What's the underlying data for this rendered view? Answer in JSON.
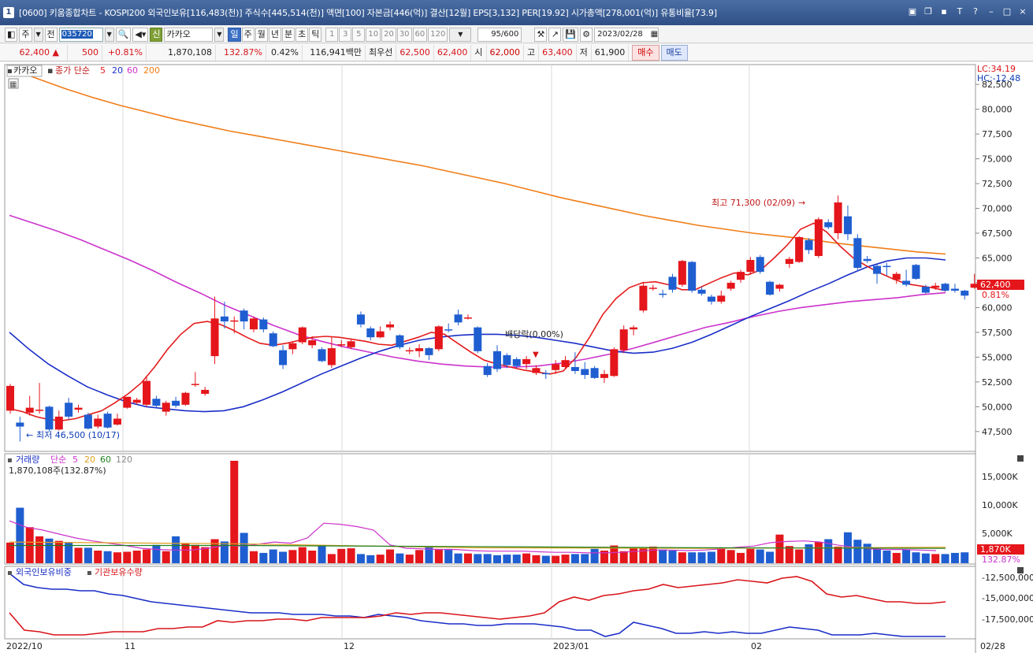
{
  "window": {
    "number": "1",
    "title": "[0600] 키움종합차트 - KOSPI200 외국인보유[116,483(천)] 주식수[445,514(천)] 액면[100] 자본금[446(억)] 결산[12월] EPS[3,132] PER[19.92] 시가총액[278,001(억)] 유통비율[73.9]"
  },
  "toolbar": {
    "market": "주",
    "all": "전",
    "code": "035720",
    "mode_badge": "신",
    "stock_name": "카카오",
    "periods": [
      "일",
      "주",
      "월",
      "년",
      "분",
      "초",
      "틱"
    ],
    "active_period": "일",
    "intervals": [
      "1",
      "3",
      "5",
      "10",
      "20",
      "30",
      "60",
      "120"
    ],
    "count": "95/600",
    "date": "2023/02/28"
  },
  "quote": {
    "price": "62,400",
    "change": "500",
    "rate": "+0.81%",
    "volume": "1,870,108",
    "vol_ratio": "132.87%",
    "turnover": "0.42%",
    "amount": "116,941백만",
    "pref_label": "최우선",
    "ask": "62,500",
    "bid": "62,400",
    "open_label": "시",
    "open": "62,000",
    "high_label": "고",
    "high": "63,400",
    "low_label": "저",
    "low": "61,900",
    "buy": "매수",
    "sell": "매도"
  },
  "price_panel": {
    "name_tag": "카카오",
    "ma_label": "종가 단순",
    "ma_periods": [
      "5",
      "20",
      "60",
      "200"
    ],
    "lc": "LC:34.19",
    "hc": "HC:-12.48",
    "current_tag": "62,400",
    "current_rate": "0.81%",
    "max_annot": "최고 71,300 (02/09)",
    "min_annot": "최저 46,500 (10/17)",
    "div_annot": "배당락(0.00%)"
  },
  "volume_panel": {
    "label": "거래량",
    "ma_label": "단순",
    "ma_periods": [
      "5",
      "20",
      "60",
      "120"
    ],
    "value_text": "1,870,108주(132.87%)",
    "axis": [
      "15,000K",
      "10,000K",
      "5,000K"
    ],
    "tag_value": "1,870K",
    "tag_rate": "132.87%"
  },
  "foreign_panel": {
    "label1": "외국인보유비중",
    "label2": "기관보유수량",
    "axis": [
      "-12,500,000",
      "-15,000,000",
      "-17,500,000"
    ]
  },
  "x_labels": [
    "2022/10",
    "11",
    "12",
    "2023/01",
    "02",
    "02/28"
  ],
  "colors": {
    "up": "#e4161b",
    "down": "#1f5ed1",
    "ma5": "#e41c1c",
    "ma20": "#1a2ec8",
    "ma60": "#cc33cc",
    "ma200": "#f07d18"
  },
  "chart_data": {
    "type": "candlestick",
    "ylim": [
      45500,
      84500
    ],
    "yticks": [
      82500,
      80000,
      77500,
      75000,
      72500,
      70000,
      67500,
      65000,
      62500,
      60000,
      57500,
      55000,
      52500,
      50000,
      47500
    ],
    "candles": [
      {
        "o": 49600,
        "c": 52100,
        "h": 52300,
        "l": 49300
      },
      {
        "o": 48400,
        "c": 48000,
        "h": 49000,
        "l": 46500
      },
      {
        "o": 49400,
        "c": 49900,
        "h": 51100,
        "l": 49100
      },
      {
        "o": 49600,
        "c": 49700,
        "h": 52400,
        "l": 49300
      },
      {
        "o": 50000,
        "c": 47700,
        "h": 50100,
        "l": 47500
      },
      {
        "o": 47700,
        "c": 49000,
        "h": 49600,
        "l": 47600
      },
      {
        "o": 50400,
        "c": 49000,
        "h": 50900,
        "l": 48700
      },
      {
        "o": 49700,
        "c": 49900,
        "h": 50200,
        "l": 49400
      },
      {
        "o": 49200,
        "c": 47800,
        "h": 49400,
        "l": 47700
      },
      {
        "o": 48000,
        "c": 48800,
        "h": 49200,
        "l": 47800
      },
      {
        "o": 49300,
        "c": 47900,
        "h": 49500,
        "l": 47800
      },
      {
        "o": 48200,
        "c": 48800,
        "h": 49300,
        "l": 48100
      },
      {
        "o": 49900,
        "c": 51000,
        "h": 51000,
        "l": 49800
      },
      {
        "o": 50400,
        "c": 50700,
        "h": 50900,
        "l": 50200
      },
      {
        "o": 50200,
        "c": 52600,
        "h": 53100,
        "l": 50000
      },
      {
        "o": 50800,
        "c": 50100,
        "h": 51100,
        "l": 49900
      },
      {
        "o": 49500,
        "c": 50400,
        "h": 50600,
        "l": 49100
      },
      {
        "o": 50600,
        "c": 50100,
        "h": 51000,
        "l": 49900
      },
      {
        "o": 50200,
        "c": 51400,
        "h": 51500,
        "l": 50100
      },
      {
        "o": 52200,
        "c": 52300,
        "h": 53500,
        "l": 52000
      },
      {
        "o": 51300,
        "c": 51700,
        "h": 52000,
        "l": 51100
      },
      {
        "o": 55100,
        "c": 58900,
        "h": 61100,
        "l": 54300
      },
      {
        "o": 59100,
        "c": 58600,
        "h": 60600,
        "l": 57900
      },
      {
        "o": 58600,
        "c": 58700,
        "h": 59100,
        "l": 57400
      },
      {
        "o": 59700,
        "c": 58600,
        "h": 59900,
        "l": 57800
      },
      {
        "o": 57800,
        "c": 58900,
        "h": 59100,
        "l": 57500
      },
      {
        "o": 58800,
        "c": 57800,
        "h": 59000,
        "l": 57500
      },
      {
        "o": 57400,
        "c": 56100,
        "h": 57600,
        "l": 56000
      },
      {
        "o": 55700,
        "c": 54200,
        "h": 56200,
        "l": 53800
      },
      {
        "o": 55800,
        "c": 56400,
        "h": 56500,
        "l": 55300
      },
      {
        "o": 56500,
        "c": 58000,
        "h": 58100,
        "l": 56300
      },
      {
        "o": 56200,
        "c": 56700,
        "h": 57100,
        "l": 55900
      },
      {
        "o": 55800,
        "c": 54600,
        "h": 56000,
        "l": 54500
      },
      {
        "o": 54200,
        "c": 55900,
        "h": 57000,
        "l": 53900
      },
      {
        "o": 56300,
        "c": 56300,
        "h": 56700,
        "l": 56000
      },
      {
        "o": 56000,
        "c": 56600,
        "h": 56800,
        "l": 55800
      },
      {
        "o": 59300,
        "c": 58300,
        "h": 59600,
        "l": 58000
      },
      {
        "o": 57900,
        "c": 57000,
        "h": 58100,
        "l": 56700
      },
      {
        "o": 57000,
        "c": 57600,
        "h": 58100,
        "l": 56900
      },
      {
        "o": 58000,
        "c": 58300,
        "h": 58600,
        "l": 57700
      },
      {
        "o": 57200,
        "c": 56000,
        "h": 57300,
        "l": 55800
      },
      {
        "o": 55700,
        "c": 55700,
        "h": 56000,
        "l": 55300
      },
      {
        "o": 55600,
        "c": 55900,
        "h": 56300,
        "l": 55000
      },
      {
        "o": 55900,
        "c": 55200,
        "h": 56000,
        "l": 54700
      },
      {
        "o": 55800,
        "c": 58100,
        "h": 58200,
        "l": 55600
      },
      {
        "o": 57800,
        "c": 57700,
        "h": 58400,
        "l": 57500
      },
      {
        "o": 59300,
        "c": 58500,
        "h": 59800,
        "l": 58200
      },
      {
        "o": 59000,
        "c": 59000,
        "h": 59300,
        "l": 58800
      },
      {
        "o": 58000,
        "c": 55600,
        "h": 58100,
        "l": 55400
      },
      {
        "o": 54100,
        "c": 53200,
        "h": 54400,
        "l": 53000
      },
      {
        "o": 55600,
        "c": 53800,
        "h": 56200,
        "l": 53500
      },
      {
        "o": 55200,
        "c": 54200,
        "h": 55400,
        "l": 53900
      },
      {
        "o": 54800,
        "c": 54100,
        "h": 55000,
        "l": 53900
      },
      {
        "o": 54300,
        "c": 54800,
        "h": 55100,
        "l": 53800
      },
      {
        "o": 53400,
        "c": 53900,
        "h": 54200,
        "l": 53200
      },
      {
        "o": 53400,
        "c": 53300,
        "h": 53700,
        "l": 52800
      },
      {
        "o": 53700,
        "c": 54300,
        "h": 54700,
        "l": 53300
      },
      {
        "o": 54000,
        "c": 54700,
        "h": 55100,
        "l": 53800
      },
      {
        "o": 54000,
        "c": 53600,
        "h": 55500,
        "l": 53300
      },
      {
        "o": 53800,
        "c": 53200,
        "h": 54500,
        "l": 52800
      },
      {
        "o": 53900,
        "c": 52900,
        "h": 54100,
        "l": 52800
      },
      {
        "o": 52900,
        "c": 53300,
        "h": 53700,
        "l": 52400
      },
      {
        "o": 53100,
        "c": 55800,
        "h": 56000,
        "l": 53000
      },
      {
        "o": 55700,
        "c": 57800,
        "h": 58200,
        "l": 55400
      },
      {
        "o": 57800,
        "c": 58000,
        "h": 58200,
        "l": 57200
      },
      {
        "o": 59700,
        "c": 62200,
        "h": 62600,
        "l": 59500
      },
      {
        "o": 62000,
        "c": 62000,
        "h": 62300,
        "l": 61700
      },
      {
        "o": 61400,
        "c": 61300,
        "h": 61800,
        "l": 61000
      },
      {
        "o": 63100,
        "c": 61800,
        "h": 63400,
        "l": 61500
      },
      {
        "o": 62300,
        "c": 64700,
        "h": 64800,
        "l": 62100
      },
      {
        "o": 64600,
        "c": 61700,
        "h": 64700,
        "l": 61500
      },
      {
        "o": 61800,
        "c": 61400,
        "h": 62100,
        "l": 61200
      },
      {
        "o": 61100,
        "c": 60600,
        "h": 61300,
        "l": 60300
      },
      {
        "o": 60600,
        "c": 61200,
        "h": 61700,
        "l": 60400
      },
      {
        "o": 61900,
        "c": 62500,
        "h": 62700,
        "l": 61700
      },
      {
        "o": 62800,
        "c": 63600,
        "h": 63800,
        "l": 62500
      },
      {
        "o": 63600,
        "c": 64800,
        "h": 65100,
        "l": 63300
      },
      {
        "o": 65100,
        "c": 63600,
        "h": 65300,
        "l": 63400
      },
      {
        "o": 62600,
        "c": 61300,
        "h": 62700,
        "l": 61200
      },
      {
        "o": 61900,
        "c": 62300,
        "h": 62400,
        "l": 61600
      },
      {
        "o": 64400,
        "c": 64900,
        "h": 65100,
        "l": 64000
      },
      {
        "o": 64600,
        "c": 67100,
        "h": 67200,
        "l": 64500
      },
      {
        "o": 66800,
        "c": 65800,
        "h": 67000,
        "l": 65400
      },
      {
        "o": 65200,
        "c": 68900,
        "h": 69100,
        "l": 65000
      },
      {
        "o": 68600,
        "c": 68100,
        "h": 68900,
        "l": 67900
      },
      {
        "o": 67500,
        "c": 70600,
        "h": 71300,
        "l": 66900
      },
      {
        "o": 69200,
        "c": 67400,
        "h": 70300,
        "l": 66800
      },
      {
        "o": 67000,
        "c": 64000,
        "h": 67400,
        "l": 63800
      },
      {
        "o": 64900,
        "c": 64700,
        "h": 65200,
        "l": 64500
      },
      {
        "o": 64200,
        "c": 63400,
        "h": 64400,
        "l": 62400
      },
      {
        "o": 64200,
        "c": 64100,
        "h": 64500,
        "l": 63200
      },
      {
        "o": 62800,
        "c": 63400,
        "h": 63600,
        "l": 62400
      },
      {
        "o": 62700,
        "c": 62300,
        "h": 63800,
        "l": 62100
      },
      {
        "o": 64300,
        "c": 62900,
        "h": 64400,
        "l": 62800
      },
      {
        "o": 62100,
        "c": 61500,
        "h": 62300,
        "l": 61400
      },
      {
        "o": 62000,
        "c": 62200,
        "h": 62500,
        "l": 61800
      },
      {
        "o": 62400,
        "c": 61700,
        "h": 62500,
        "l": 61600
      },
      {
        "o": 61900,
        "c": 61700,
        "h": 62400,
        "l": 61500
      },
      {
        "o": 61700,
        "c": 61200,
        "h": 61800,
        "l": 60800
      },
      {
        "o": 62000,
        "c": 62400,
        "h": 63400,
        "l": 61900
      }
    ],
    "ma200": [
      84100,
      83100,
      82100,
      81200,
      80400,
      79700,
      79000,
      78400,
      77800,
      77300,
      76800,
      76300,
      75800,
      75300,
      74800,
      74300,
      73700,
      73100,
      72500,
      71800,
      71100,
      70500,
      69900,
      69300,
      68800,
      68300,
      67900,
      67500,
      67200,
      66900,
      66500,
      66200,
      65900,
      65600,
      65400
    ],
    "ma60": [
      69300,
      68500,
      67700,
      66800,
      65800,
      64800,
      63700,
      62500,
      61400,
      60200,
      59200,
      58200,
      57300,
      56600,
      56000,
      55500,
      55000,
      54600,
      54300,
      54100,
      54000,
      54000,
      54100,
      54400,
      54800,
      55300,
      55900,
      56600,
      57300,
      58000,
      58500,
      59100,
      59600,
      60000,
      60300,
      60600,
      60800,
      61000,
      61300,
      61500
    ],
    "ma20": [
      57500,
      55800,
      54300,
      53100,
      52000,
      51200,
      50500,
      50000,
      49800,
      49600,
      49500,
      49600,
      50000,
      50700,
      51500,
      52400,
      53300,
      54100,
      54900,
      55600,
      56200,
      56700,
      57000,
      57200,
      57300,
      57300,
      57200,
      57000,
      56700,
      56400,
      56000,
      55600,
      55400,
      55500,
      55900,
      56500,
      57300,
      58200,
      59100,
      59900,
      60700,
      61600,
      62400,
      63300,
      64100,
      64700,
      65000,
      65000,
      64800
    ],
    "ma5": [
      49800,
      49500,
      49000,
      48700,
      48600,
      48800,
      49200,
      49600,
      50400,
      51300,
      52400,
      54000,
      55800,
      57300,
      58400,
      58600,
      58300,
      57700,
      57000,
      56400,
      56200,
      56400,
      56700,
      57000,
      57100,
      57000,
      56800,
      56600,
      56300,
      56200,
      56600,
      57000,
      57500,
      57300,
      56400,
      55500,
      54700,
      54300,
      54000,
      53700,
      53500,
      53300,
      53600,
      55000,
      57000,
      59300,
      60900,
      62000,
      62500,
      62600,
      62300,
      61800,
      61800,
      62400,
      63000,
      63500,
      63300,
      63800,
      65000,
      66300,
      67900,
      68500,
      67600,
      66200,
      65000,
      64200,
      63500,
      62900,
      62400,
      62200,
      62000,
      61700
    ]
  },
  "volume_data": [
    3600,
    9700,
    6300,
    4700,
    4300,
    3900,
    3700,
    2700,
    2700,
    2200,
    2100,
    1900,
    2000,
    2200,
    2400,
    3200,
    2100,
    4700,
    3400,
    3200,
    2800,
    4200,
    3800,
    17900,
    5300,
    2100,
    1800,
    2400,
    2000,
    2300,
    2800,
    2200,
    3100,
    1600,
    2500,
    2600,
    1600,
    1400,
    1500,
    2400,
    1700,
    1500,
    2300,
    3000,
    2500,
    2500,
    1700,
    1700,
    1600,
    1600,
    1400,
    1500,
    1500,
    1700,
    1400,
    1300,
    1300,
    1500,
    1600,
    1600,
    2500,
    2200,
    3100,
    2100,
    2600,
    2800,
    2900,
    2400,
    2200,
    1900,
    1900,
    1900,
    2000,
    2500,
    2300,
    1800,
    2500,
    2400,
    2000,
    5000,
    3000,
    2400,
    3300,
    3700,
    4200,
    2900,
    5400,
    4100,
    3400,
    2500,
    2200,
    1800,
    2400,
    1900,
    1700,
    1600,
    1600,
    1800,
    1900
  ]
}
